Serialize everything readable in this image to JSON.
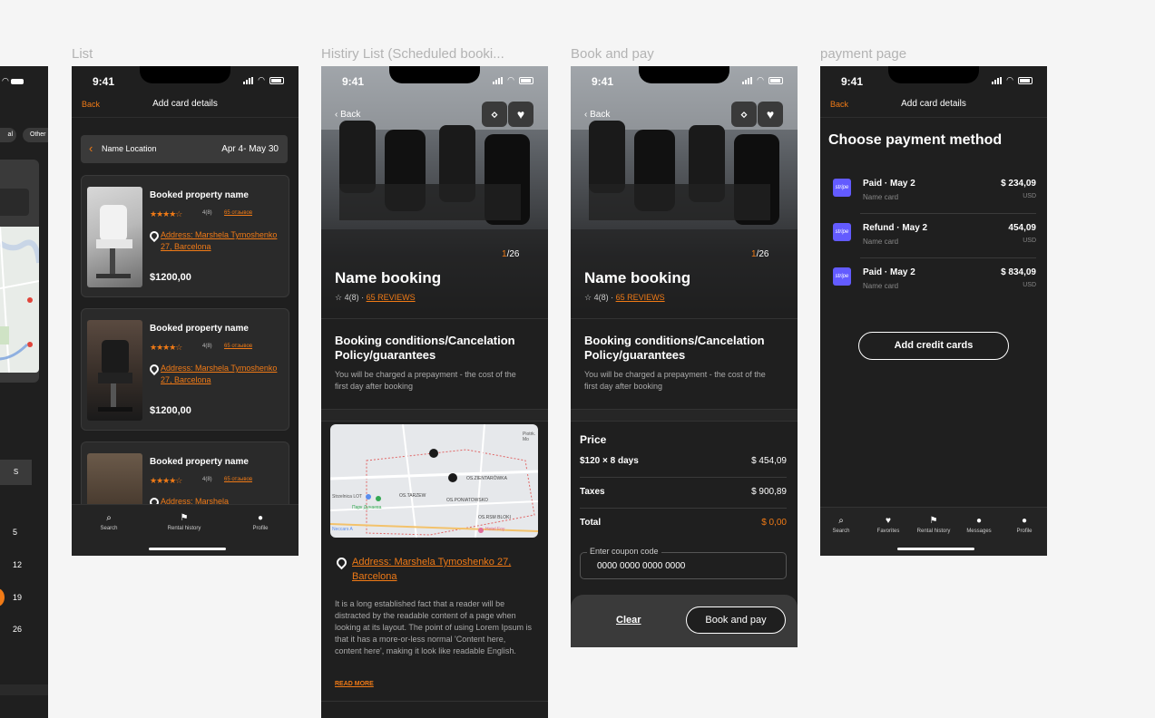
{
  "frame_titles": {
    "list": "List",
    "history": "Histiry List (Scheduled booki...",
    "book_pay": "Book and pay",
    "payment": "payment page"
  },
  "status": {
    "time": "9:41"
  },
  "left_partial": {
    "chips": [
      "al",
      "Other"
    ],
    "calendar_letter": "S",
    "dates": [
      "5",
      "12",
      "19",
      "26"
    ]
  },
  "list_screen": {
    "nav": {
      "back": "Back",
      "title": "Add card details"
    },
    "filter": {
      "location": "Name Location",
      "dates": "Apr 4- May 30"
    },
    "cards": [
      {
        "title": "Booked property name",
        "stars": "★★★★☆",
        "rating": "4(8)",
        "reviews": "65 отзывов",
        "address": "Address: Marshela Tymoshenko 27, Barcelona",
        "price": "$1200,00"
      },
      {
        "title": "Booked property name",
        "stars": "★★★★☆",
        "rating": "4(8)",
        "reviews": "65 отзывов",
        "address": "Address: Marshela Tymoshenko 27, Barcelona",
        "price": "$1200,00"
      },
      {
        "title": "Booked property name",
        "stars": "★★★★☆",
        "rating": "4(8)",
        "reviews": "65 отзывов",
        "address": "Address: Marshela"
      }
    ],
    "tabs": [
      {
        "icon": "search-icon",
        "label": "Search"
      },
      {
        "icon": "rental-history-icon",
        "label": "Rental history"
      },
      {
        "icon": "profile-icon",
        "label": "Profile"
      }
    ]
  },
  "history_screen": {
    "back": "Back",
    "counter_current": "1",
    "counter_total": "/26",
    "name": "Name booking",
    "rating": "☆ 4(8)  ·",
    "reviews": "65 REVIEWS",
    "conditions_title": "Booking conditions/Cancelation Policy/guarantees",
    "conditions_text": "You will be charged a prepayment - the cost of the first day after booking",
    "map_labels": [
      "Piotrk. Mo",
      "OS.ZIENTARÓWKA",
      "OS.TARZEW",
      "OS.PONIATOWSKO",
      "Strzelnica LOT",
      "Парк Дунаева",
      "OS.RSM BLOKI",
      "Hotel Foy",
      "Neccars A"
    ],
    "address": "Address: Marshela Tymoshenko 27, Barcelona",
    "description": "It is a long established fact that a reader will be distracted by the readable content of a page when looking at its layout. The point of using Lorem Ipsum is that it has a more-or-less normal 'Content here, content here', making it look like readable English.",
    "read_more": "READ MORE"
  },
  "book_pay_screen": {
    "back": "Back",
    "counter_current": "1",
    "counter_total": "/26",
    "name": "Name booking",
    "rating": "☆ 4(8)  ·",
    "reviews": "65 REVIEWS",
    "conditions_title": "Booking conditions/Cancelation Policy/guarantees",
    "conditions_text": "You will be charged a prepayment - the cost of the first day after booking",
    "price_title": "Price",
    "rows": [
      {
        "label": "$120 × 8 days",
        "value": "$ 454,09"
      },
      {
        "label": "Taxes",
        "value": "$ 900,89"
      },
      {
        "label": "Total",
        "value": "$ 0,00"
      }
    ],
    "coupon_label": "Enter coupon code",
    "coupon_value": "0000 0000 0000 0000",
    "clear": "Clear",
    "book": "Book and pay"
  },
  "payment_screen": {
    "nav": {
      "back": "Back",
      "title": "Add card details"
    },
    "heading": "Choose payment method",
    "items": [
      {
        "logo": "stripe",
        "title": "Paid · May 2",
        "sub": "Name card",
        "amount": "$ 234,09",
        "currency": "USD"
      },
      {
        "logo": "stripe",
        "title": "Refund · May 2",
        "sub": "Name card",
        "amount": "454,09",
        "currency": "USD"
      },
      {
        "logo": "stripe",
        "title": "Paid · May 2",
        "sub": "Name card",
        "amount": "$ 834,09",
        "currency": "USD"
      }
    ],
    "add_button": "Add credit cards",
    "tabs": [
      {
        "icon": "search-icon",
        "label": "Search"
      },
      {
        "icon": "heart-icon",
        "label": "Favorites"
      },
      {
        "icon": "rental-history-icon",
        "label": "Rental history"
      },
      {
        "icon": "chat-icon",
        "label": "Messages"
      },
      {
        "icon": "profile-icon",
        "label": "Profile"
      }
    ]
  },
  "colors": {
    "accent": "#f07a16",
    "background": "#1f1f1f",
    "canvas": "#f5f5f5",
    "stripe": "#635bff"
  }
}
